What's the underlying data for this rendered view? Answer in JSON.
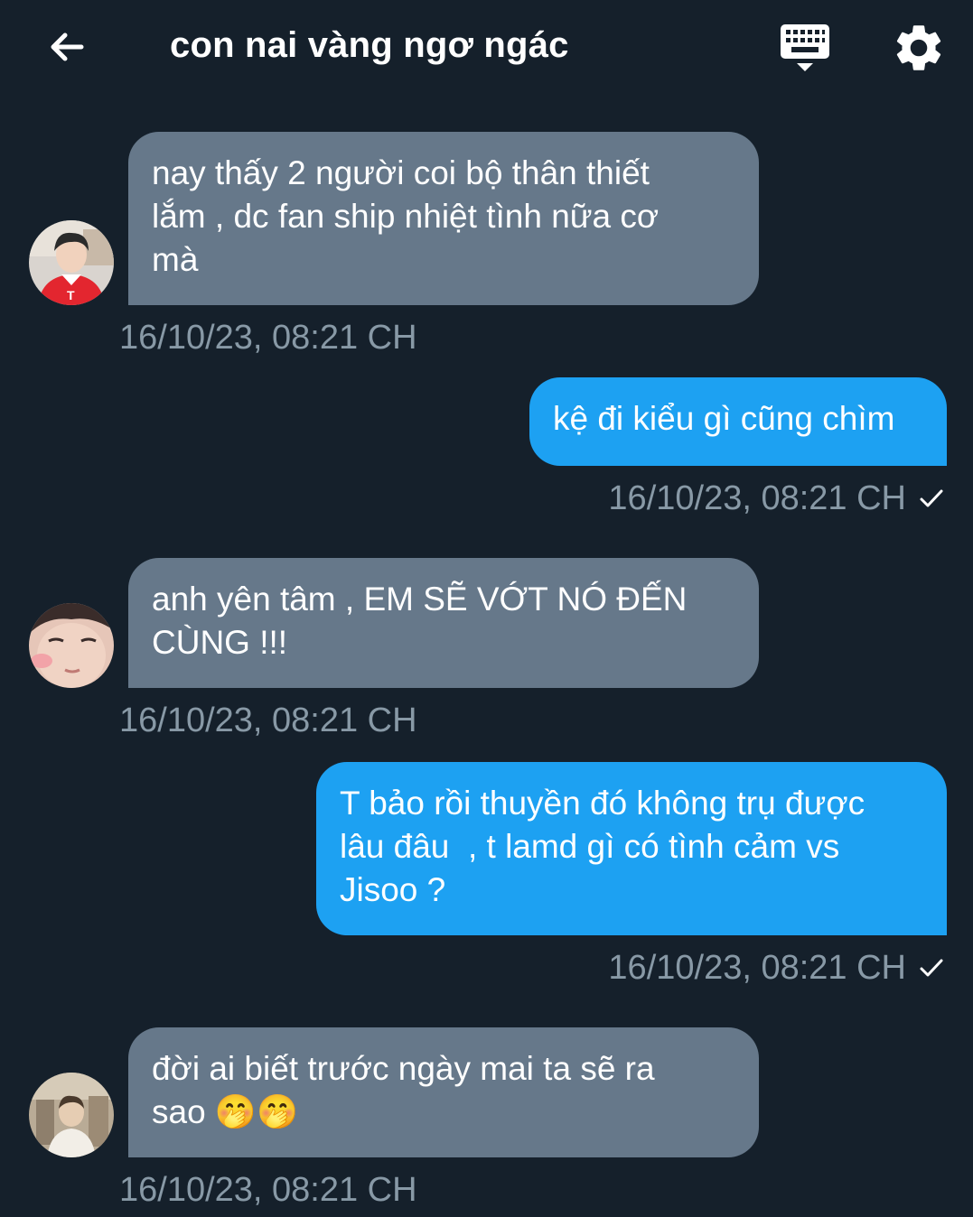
{
  "header": {
    "title": "con nai vàng ngơ ngác",
    "back_icon": "arrow-left-icon",
    "keyboard_icon": "keyboard-icon",
    "settings_icon": "gear-icon"
  },
  "colors": {
    "background": "#15202b",
    "incoming_bubble": "#66788a",
    "outgoing_bubble": "#1da1f2",
    "timestamp": "#8899a6"
  },
  "messages": [
    {
      "direction": "in",
      "text": "nay thấy 2 người coi bộ thân thiết\nlắm , dc fan ship nhiệt tình nữa cơ\nmà",
      "timestamp": "16/10/23, 08:21 CH"
    },
    {
      "direction": "out",
      "text": "kệ đi kiểu gì cũng chìm",
      "timestamp": "16/10/23, 08:21 CH",
      "status_icon": "check-icon"
    },
    {
      "direction": "in",
      "text": "anh yên tâm , EM SẼ VỚT NÓ ĐẾN\nCÙNG !!!",
      "timestamp": "16/10/23, 08:21 CH"
    },
    {
      "direction": "out",
      "text": "T bảo rồi thuyền đó không trụ được\nlâu đâu  , t lamd gì có tình cảm vs\nJisoo ?",
      "timestamp": "16/10/23, 08:21 CH",
      "status_icon": "check-icon"
    },
    {
      "direction": "in",
      "text": "đời ai biết trước ngày mai ta sẽ ra\nsao 🤭🤭",
      "timestamp": "16/10/23, 08:21 CH"
    }
  ]
}
